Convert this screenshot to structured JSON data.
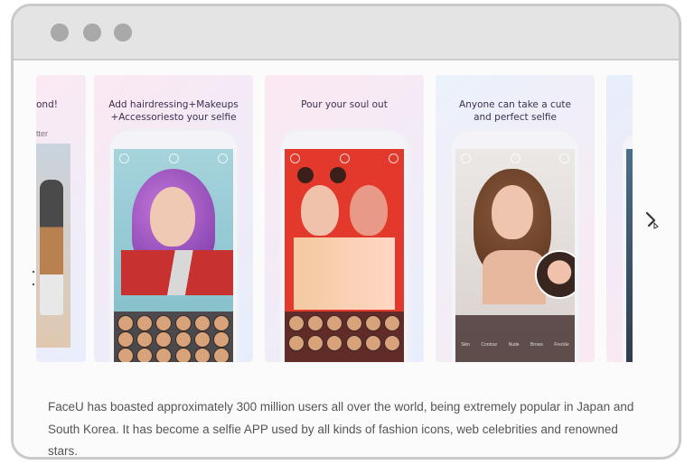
{
  "window": {
    "controls": [
      "close",
      "minimize",
      "maximize"
    ]
  },
  "carousel": {
    "cards": [
      {
        "caption": "ond!",
        "sub_caption": "tter"
      },
      {
        "caption": "Add hairdressing+Makeups\n+Accessoriesto your selfie"
      },
      {
        "caption": "Pour your soul out"
      },
      {
        "caption": "Anyone can take a cute\nand perfect selfie"
      }
    ],
    "filter_labels": [
      "Skin",
      "Contour",
      "Nude",
      "Brows",
      "Freckle"
    ],
    "next_icon": "chevron-right-icon"
  },
  "description": "FaceU has boasted approximately 300 million users all over the world, being extremely popular in Japan and South Korea. It has become a selfie APP used by all kinds of fashion icons, web celebrities and renowned stars.",
  "colors": {
    "titlebar": "#e4e4e4",
    "window_border": "#c9c9c9",
    "dot": "#a9a9a9",
    "text": "#555555"
  }
}
